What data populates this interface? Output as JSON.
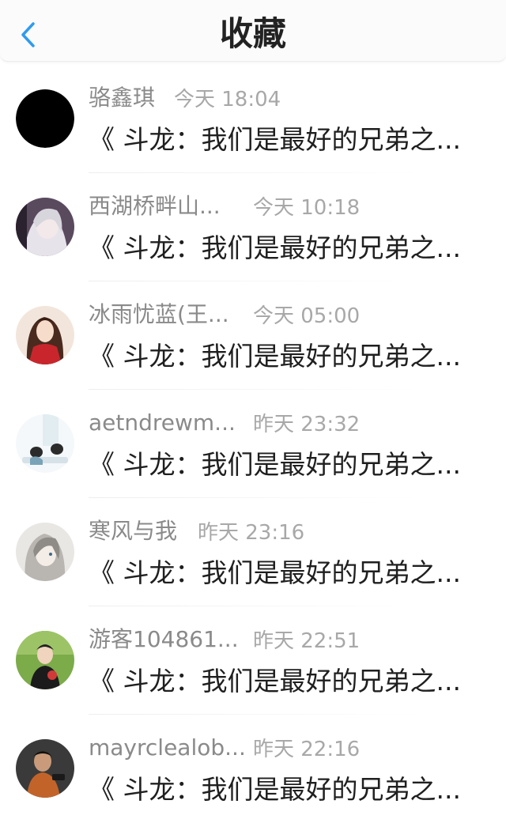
{
  "header": {
    "title": "收藏",
    "back_icon": "chevron-left-icon",
    "accent": "#2e9bf0"
  },
  "items": [
    {
      "username": "骆鑫琪",
      "time": "今天 18:04",
      "title": "《 斗龙：我们是最好的兄弟之..."
    },
    {
      "username": "西湖桥畔山...",
      "time": "今天 10:18",
      "title": "《 斗龙：我们是最好的兄弟之..."
    },
    {
      "username": "冰雨忧蓝(王...",
      "time": "今天 05:00",
      "title": "《 斗龙：我们是最好的兄弟之..."
    },
    {
      "username": "aetndrewm...",
      "time": "昨天 23:32",
      "title": "《 斗龙：我们是最好的兄弟之..."
    },
    {
      "username": "寒风与我",
      "time": "昨天 23:16",
      "title": "《 斗龙：我们是最好的兄弟之..."
    },
    {
      "username": "游客104861...",
      "time": "昨天 22:51",
      "title": "《 斗龙：我们是最好的兄弟之..."
    },
    {
      "username": "mayrclealob...",
      "time": "昨天 22:16",
      "title": "《 斗龙：我们是最好的兄弟之..."
    }
  ]
}
